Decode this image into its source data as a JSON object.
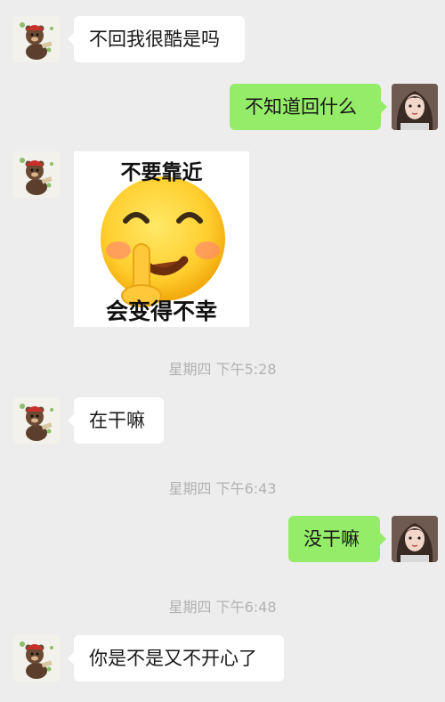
{
  "messages": [
    {
      "side": "left",
      "type": "text",
      "text": "不回我很酷是吗"
    },
    {
      "side": "right",
      "type": "text",
      "text": "不知道回什么"
    },
    {
      "side": "left",
      "type": "sticker",
      "top_text": "不要靠近",
      "bottom_text": "会变得不幸",
      "icon": "shh-emoji-icon"
    },
    {
      "type": "timestamp",
      "text": "星期四 下午5:28"
    },
    {
      "side": "left",
      "type": "text",
      "text": "在干嘛"
    },
    {
      "type": "timestamp",
      "text": "星期四 下午6:43"
    },
    {
      "side": "right",
      "type": "text",
      "text": "没干嘛"
    },
    {
      "type": "timestamp",
      "text": "星期四 下午6:48"
    },
    {
      "side": "left",
      "type": "text",
      "text": "你是不是又不开心了"
    }
  ],
  "avatars": {
    "left": "bear-avatar-icon",
    "right": "girl-avatar-icon"
  },
  "colors": {
    "background": "#ededed",
    "incoming_bubble": "#ffffff",
    "outgoing_bubble": "#95ec69",
    "timestamp_text": "#b2b2b2"
  }
}
